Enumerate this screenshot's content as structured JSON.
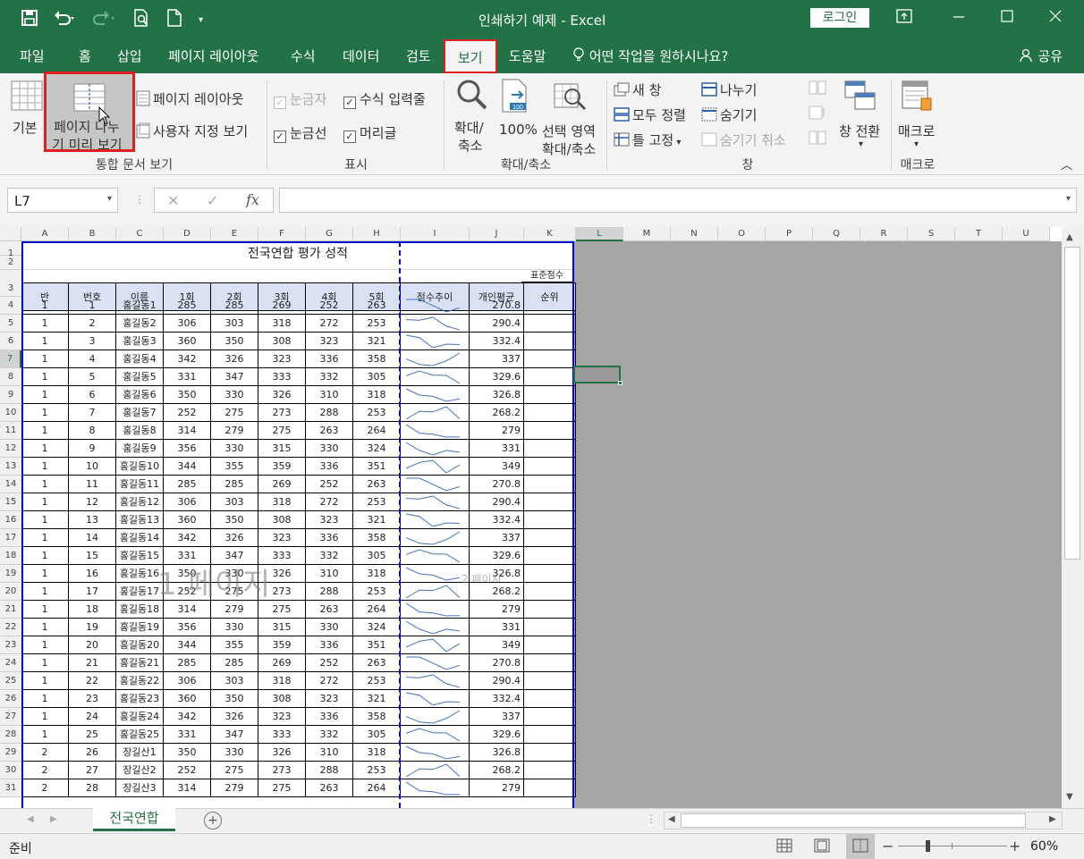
{
  "titlebar": {
    "title": "인쇄하기 예제  -  Excel",
    "login": "로그인",
    "save_icon": "save-icon",
    "undo_icon": "undo-icon",
    "redo_icon": "redo-icon",
    "preview_icon": "print-preview-icon",
    "new_icon": "new-file-icon"
  },
  "tabs": [
    "파일",
    "홈",
    "삽입",
    "페이지 레이아웃",
    "수식",
    "데이터",
    "검토",
    "보기",
    "도움말",
    "어떤 작업을 원하시나요?"
  ],
  "active_tab": "보기",
  "share": "공유",
  "ribbon": {
    "workbook_views": {
      "label": "통합 문서 보기",
      "normal": "기본",
      "pagebreak_line1": "페이지 나누",
      "pagebreak_line2": "기 미리 보기",
      "page_layout": "페이지 레이아웃",
      "custom_views": "사용자 지정 보기"
    },
    "show": {
      "label": "표시",
      "ruler": "눈금자",
      "formula_bar": "수식 입력줄",
      "gridlines": "눈금선",
      "headings": "머리글"
    },
    "zoom": {
      "label": "확대/축소",
      "zoom_line1": "확대/",
      "zoom_line2": "축소",
      "hundred": "100%",
      "sel_line1": "선택 영역",
      "sel_line2": "확대/축소"
    },
    "window": {
      "label": "창",
      "new_window": "새 창",
      "arrange_all": "모두 정렬",
      "freeze": "틀 고정",
      "split": "나누기",
      "hide": "숨기기",
      "unhide": "숨기기 취소",
      "switch": "창 전환"
    },
    "macros": {
      "label": "매크로",
      "button": "매크로"
    }
  },
  "formula": {
    "namebox": "L7",
    "cancel": "✕",
    "enter": "✓",
    "fx": "fx",
    "value": ""
  },
  "columns": [
    "A",
    "B",
    "C",
    "D",
    "E",
    "F",
    "G",
    "H",
    "I",
    "J",
    "K",
    "L",
    "M",
    "N",
    "O",
    "P",
    "Q",
    "R",
    "S",
    "T",
    "U"
  ],
  "sheet": {
    "title": "전국연합 평가 성적",
    "std_score": "표준점수",
    "headers": [
      "반",
      "번호",
      "이름",
      "1회",
      "2회",
      "3회",
      "4회",
      "5회",
      "점수추이",
      "개인평균",
      "순위"
    ],
    "rows": [
      [
        "1",
        "1",
        "홍길동1",
        "285",
        "285",
        "269",
        "252",
        "263",
        "270.8"
      ],
      [
        "1",
        "2",
        "홍길동2",
        "306",
        "303",
        "318",
        "272",
        "253",
        "290.4"
      ],
      [
        "1",
        "3",
        "홍길동3",
        "360",
        "350",
        "308",
        "323",
        "321",
        "332.4"
      ],
      [
        "1",
        "4",
        "홍길동4",
        "342",
        "326",
        "323",
        "336",
        "358",
        "337"
      ],
      [
        "1",
        "5",
        "홍길동5",
        "331",
        "347",
        "333",
        "332",
        "305",
        "329.6"
      ],
      [
        "1",
        "6",
        "홍길동6",
        "350",
        "330",
        "326",
        "310",
        "318",
        "326.8"
      ],
      [
        "1",
        "7",
        "홍길동7",
        "252",
        "275",
        "273",
        "288",
        "253",
        "268.2"
      ],
      [
        "1",
        "8",
        "홍길동8",
        "314",
        "279",
        "275",
        "263",
        "264",
        "279"
      ],
      [
        "1",
        "9",
        "홍길동9",
        "356",
        "330",
        "315",
        "330",
        "324",
        "331"
      ],
      [
        "1",
        "10",
        "홍길동10",
        "344",
        "355",
        "359",
        "336",
        "351",
        "349"
      ],
      [
        "1",
        "11",
        "홍길동11",
        "285",
        "285",
        "269",
        "252",
        "263",
        "270.8"
      ],
      [
        "1",
        "12",
        "홍길동12",
        "306",
        "303",
        "318",
        "272",
        "253",
        "290.4"
      ],
      [
        "1",
        "13",
        "홍길동13",
        "360",
        "350",
        "308",
        "323",
        "321",
        "332.4"
      ],
      [
        "1",
        "14",
        "홍길동14",
        "342",
        "326",
        "323",
        "336",
        "358",
        "337"
      ],
      [
        "1",
        "15",
        "홍길동15",
        "331",
        "347",
        "333",
        "332",
        "305",
        "329.6"
      ],
      [
        "1",
        "16",
        "홍길동16",
        "350",
        "330",
        "326",
        "310",
        "318",
        "326.8"
      ],
      [
        "1",
        "17",
        "홍길동17",
        "252",
        "275",
        "273",
        "288",
        "253",
        "268.2"
      ],
      [
        "1",
        "18",
        "홍길동18",
        "314",
        "279",
        "275",
        "263",
        "264",
        "279"
      ],
      [
        "1",
        "19",
        "홍길동19",
        "356",
        "330",
        "315",
        "330",
        "324",
        "331"
      ],
      [
        "1",
        "20",
        "홍길동20",
        "344",
        "355",
        "359",
        "336",
        "351",
        "349"
      ],
      [
        "1",
        "21",
        "홍길동21",
        "285",
        "285",
        "269",
        "252",
        "263",
        "270.8"
      ],
      [
        "1",
        "22",
        "홍길동22",
        "306",
        "303",
        "318",
        "272",
        "253",
        "290.4"
      ],
      [
        "1",
        "23",
        "홍길동23",
        "360",
        "350",
        "308",
        "323",
        "321",
        "332.4"
      ],
      [
        "1",
        "24",
        "홍길동24",
        "342",
        "326",
        "323",
        "336",
        "358",
        "337"
      ],
      [
        "1",
        "25",
        "홍길동25",
        "331",
        "347",
        "333",
        "332",
        "305",
        "329.6"
      ],
      [
        "2",
        "26",
        "장길산1",
        "350",
        "330",
        "326",
        "310",
        "318",
        "326.8"
      ],
      [
        "2",
        "27",
        "장길산2",
        "252",
        "275",
        "273",
        "288",
        "253",
        "268.2"
      ],
      [
        "2",
        "28",
        "장길산3",
        "314",
        "279",
        "275",
        "263",
        "264",
        "279"
      ]
    ]
  },
  "watermarks": {
    "page1": "1 페이지",
    "page2": "2 페이지"
  },
  "sheet_tab": "전국연합",
  "status": {
    "ready": "준비",
    "zoom": "60%",
    "minus": "−",
    "plus": "+"
  },
  "colors": {
    "brand": "#217346",
    "highlight": "#e02020",
    "page_border": "#0000cc",
    "out_of_print": "#a5a5a5"
  }
}
